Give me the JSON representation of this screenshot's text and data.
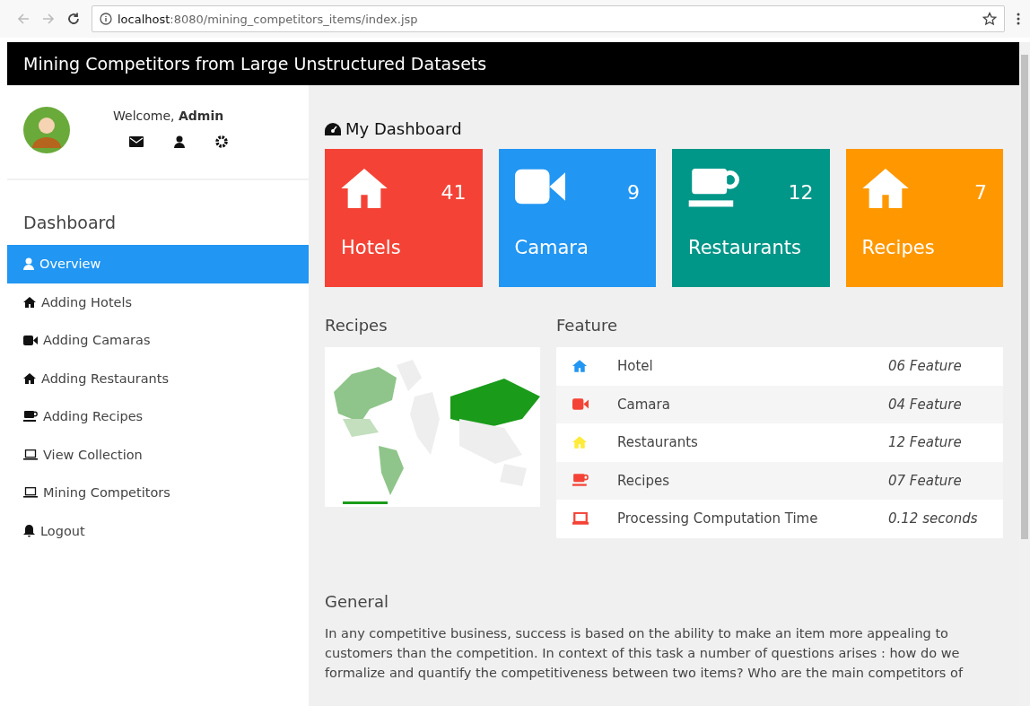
{
  "browser": {
    "url_host": "localhost",
    "url_path": ":8080/mining_competitors_items/index.jsp"
  },
  "header": {
    "title": "Mining Competitors from Large Unstructured Datasets"
  },
  "user": {
    "welcome": "Welcome, **Admin**"
  },
  "sidebar": {
    "heading": "Dashboard",
    "items": [
      {
        "label": "Overview",
        "kind": "user",
        "selected": true
      },
      {
        "label": "Adding Hotels",
        "kind": "house",
        "selected": false
      },
      {
        "label": "Adding Camaras",
        "kind": "video",
        "selected": false
      },
      {
        "label": "Adding Restaurants",
        "kind": "house",
        "selected": false
      },
      {
        "label": "Adding Recipes",
        "kind": "cup",
        "selected": false
      },
      {
        "label": "View Collection",
        "kind": "laptop",
        "selected": false
      },
      {
        "label": "Mining Competitors",
        "kind": "laptop",
        "selected": false
      },
      {
        "label": "Logout",
        "kind": "bell",
        "selected": false
      }
    ]
  },
  "dashboard": {
    "title": "My Dashboard",
    "tiles": [
      {
        "label": "Hotels",
        "count": "41",
        "kind": "house",
        "color": "#f44336"
      },
      {
        "label": "Camara",
        "count": "9",
        "kind": "video",
        "color": "#2196f3"
      },
      {
        "label": "Restaurants",
        "count": "12",
        "kind": "cup",
        "color": "#009688"
      },
      {
        "label": "Recipes",
        "count": "7",
        "kind": "house",
        "color": "#ff9800"
      }
    ]
  },
  "map_panel": {
    "title": "Recipes"
  },
  "feature": {
    "title": "Feature",
    "rows": [
      {
        "label": "Hotel",
        "value": "06 Feature",
        "kind": "house",
        "color": "#2196f3"
      },
      {
        "label": "Camara",
        "value": "04 Feature",
        "kind": "video",
        "color": "#f44336"
      },
      {
        "label": "Restaurants",
        "value": "12 Feature",
        "kind": "house",
        "color": "#ffeb3b"
      },
      {
        "label": "Recipes",
        "value": "07 Feature",
        "kind": "cup",
        "color": "#f44336"
      },
      {
        "label": "Processing Computation Time",
        "value": "0.12 seconds",
        "kind": "laptop",
        "color": "#f44336"
      }
    ]
  },
  "general": {
    "title": "General",
    "text": "In any competitive business, success is based on the ability to make an item more appealing to customers than the competition. In context of this task a number of questions arises : how do we formalize and quantify the competitiveness between two items? Who are the main competitors of"
  }
}
